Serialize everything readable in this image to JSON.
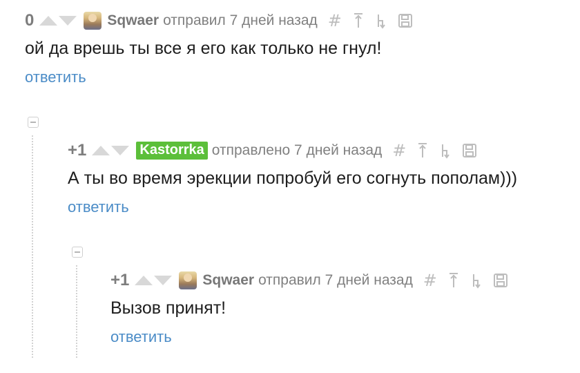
{
  "comments": [
    {
      "rating": "0",
      "username": "Sqwaer",
      "meta": "отправил 7 дней назад",
      "text": "ой да врешь ты все я его как только не гнул!",
      "reply_label": "ответить"
    },
    {
      "rating": "+1",
      "username": "Kastorrka",
      "meta": "отправлено 7 дней назад",
      "text": "А ты во время эрекции попробуй его согнуть пополам)))",
      "reply_label": "ответить"
    },
    {
      "rating": "+1",
      "username": "Sqwaer",
      "meta": "отправил 7 дней назад",
      "text": "Вызов принят!",
      "reply_label": "ответить"
    }
  ],
  "icons": {
    "link": "#",
    "parent": "arrow-up-icon",
    "branch": "branch-icon",
    "save": "save-icon"
  },
  "colors": {
    "reply_link": "#4b8cc7",
    "username_badge": "#5cbf3a",
    "muted": "#808080"
  }
}
